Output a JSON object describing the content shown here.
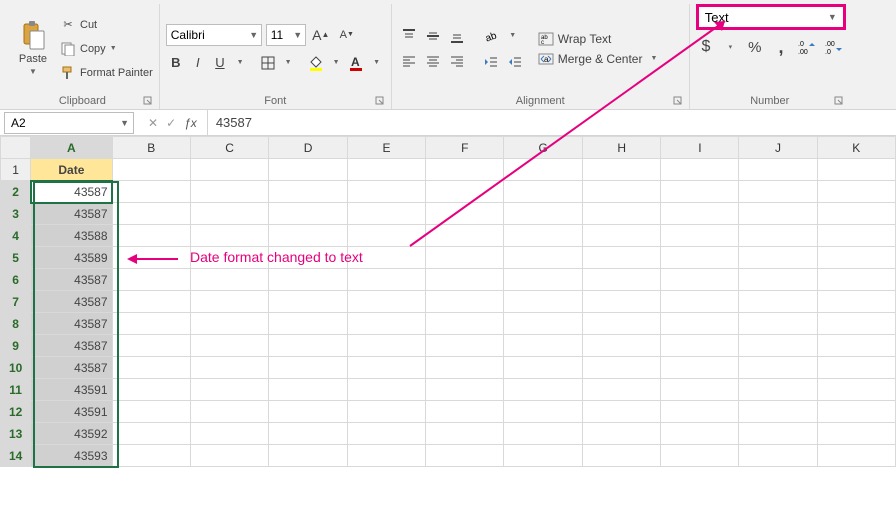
{
  "clipboard": {
    "paste": "Paste",
    "cut": "Cut",
    "copy": "Copy",
    "format_painter": "Format Painter",
    "group_label": "Clipboard"
  },
  "font": {
    "name": "Calibri",
    "size": "11",
    "group_label": "Font"
  },
  "alignment": {
    "wrap_text": "Wrap Text",
    "merge_center": "Merge & Center",
    "group_label": "Alignment"
  },
  "number": {
    "format": "Text",
    "group_label": "Number"
  },
  "namebox": "A2",
  "formula": "43587",
  "columns": [
    "A",
    "B",
    "C",
    "D",
    "E",
    "F",
    "G",
    "H",
    "I",
    "J",
    "K"
  ],
  "rows": [
    {
      "n": 1,
      "a": "Date",
      "header": true
    },
    {
      "n": 2,
      "a": "43587",
      "active": true
    },
    {
      "n": 3,
      "a": "43587"
    },
    {
      "n": 4,
      "a": "43588"
    },
    {
      "n": 5,
      "a": "43589"
    },
    {
      "n": 6,
      "a": "43587"
    },
    {
      "n": 7,
      "a": "43587"
    },
    {
      "n": 8,
      "a": "43587"
    },
    {
      "n": 9,
      "a": "43587"
    },
    {
      "n": 10,
      "a": "43587"
    },
    {
      "n": 11,
      "a": "43591"
    },
    {
      "n": 12,
      "a": "43591"
    },
    {
      "n": 13,
      "a": "43592"
    },
    {
      "n": 14,
      "a": "43593"
    }
  ],
  "annotation_text": "Date format changed to text",
  "colors": {
    "accent": "#e6007e",
    "select": "#1f7246"
  }
}
